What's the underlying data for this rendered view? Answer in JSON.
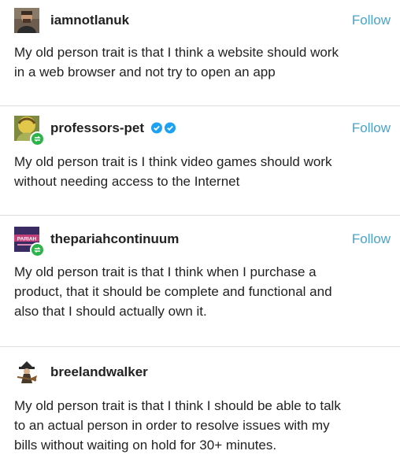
{
  "posts": [
    {
      "username": "iamnotlanuk",
      "follow_label": "Follow",
      "verified": false,
      "text_lines": [
        "My old person trait is that I think a website should work",
        "in a web browser and not try to open an app"
      ]
    },
    {
      "username": "professors-pet",
      "follow_label": "Follow",
      "verified": true,
      "text_lines": [
        "My old person trait is I think video games should work",
        "without needing access to the Internet"
      ]
    },
    {
      "username": "thepariahcontinuum",
      "follow_label": "Follow",
      "verified": false,
      "avatar_text": "PARIAH",
      "text_lines": [
        "My old person trait is that I think when I purchase a",
        "product, that it should be complete and functional and",
        "also that I should actually own it."
      ]
    },
    {
      "username": "breelandwalker",
      "follow_label": "",
      "verified": false,
      "text_lines": [
        "My old person trait is that I think I should be able to talk",
        "to an actual person in order to resolve issues with my",
        "bills without waiting on hold for 30+ minutes."
      ]
    }
  ],
  "colors": {
    "follow": "#4aa3c8",
    "verified": "#1da1f2",
    "reblog_badge": "#2cb34a",
    "divider": "#dedede"
  }
}
